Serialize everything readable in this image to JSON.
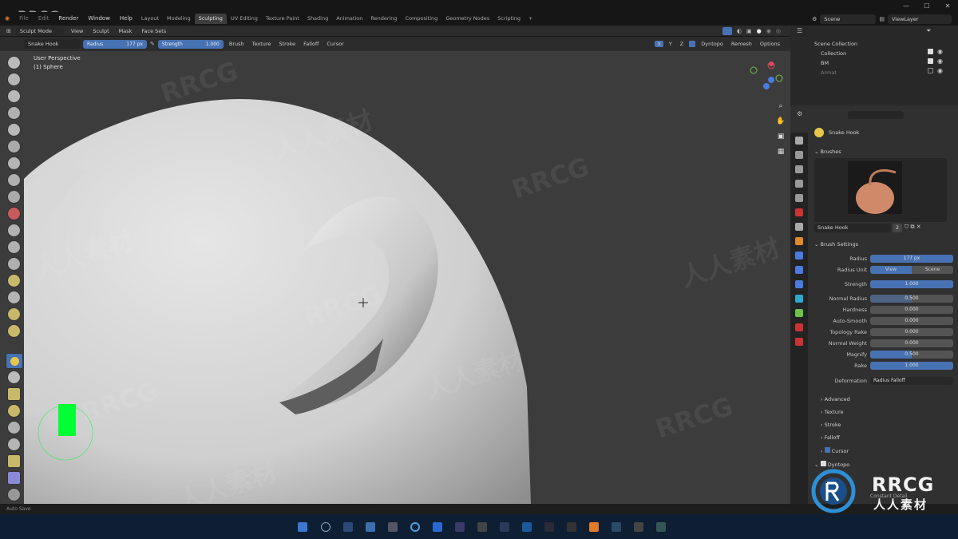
{
  "brand": "RRCG",
  "menu": {
    "items": [
      "File",
      "Edit",
      "Render",
      "Window",
      "Help"
    ],
    "workspaces": [
      "Layout",
      "Modeling",
      "Sculpting",
      "UV Editing",
      "Texture Paint",
      "Shading",
      "Animation",
      "Rendering",
      "Compositing",
      "Geometry Nodes",
      "Scripting"
    ],
    "active_workspace": "Sculpting",
    "add_tab": "+"
  },
  "header_right": {
    "scene": "Scene",
    "view_layer": "ViewLayer"
  },
  "viewport_header": {
    "mode": "Sculpt Mode",
    "menus": [
      "View",
      "Sculpt",
      "Mask",
      "Face Sets"
    ],
    "dyntopo": "Dyntopo",
    "remesh": "Remesh",
    "options": "Options",
    "axes": [
      "X",
      "Y",
      "Z"
    ]
  },
  "tool_settings": {
    "brush_name": "Snake Hook",
    "radius_label": "Radius",
    "radius_value": "177 px",
    "strength_label": "Strength",
    "strength_value": "1.000",
    "menus": [
      "Brush",
      "Texture",
      "Stroke",
      "Falloff",
      "Cursor"
    ]
  },
  "viewport": {
    "perspective": "User Perspective",
    "object": "(1) Sphere"
  },
  "outliner": {
    "title": "Scene Collection",
    "items": [
      "Collection",
      "BM",
      "Armat"
    ]
  },
  "properties": {
    "brush_header": "Snake Hook",
    "brushes_section": "Brushes",
    "brush_field": "Snake Hook",
    "brush_users": "2",
    "brush_settings_section": "Brush Settings",
    "rows": [
      {
        "label": "Radius",
        "value": "177 px",
        "fill": 1.0
      },
      {
        "label": "Strength",
        "value": "1.000",
        "fill": 1.0
      },
      {
        "label": "Normal Radius",
        "value": "0.500",
        "fill": 0.5
      },
      {
        "label": "Hardness",
        "value": "0.000",
        "fill": 0.0
      },
      {
        "label": "Auto-Smooth",
        "value": "0.000",
        "fill": 0.0
      },
      {
        "label": "Topology Rake",
        "value": "0.000",
        "fill": 0.0
      },
      {
        "label": "Normal Weight",
        "value": "0.000",
        "fill": 0.0
      },
      {
        "label": "Magnify",
        "value": "0.500",
        "fill": 0.5
      },
      {
        "label": "Rake",
        "value": "1.000",
        "fill": 1.0
      }
    ],
    "radius_unit_label": "Radius Unit",
    "radius_unit_options": [
      "View",
      "Scene"
    ],
    "deformation_label": "Deformation",
    "deformation_value": "Radius Falloff",
    "subsections": [
      "Advanced",
      "Texture",
      "Stroke",
      "Falloff",
      "Cursor"
    ],
    "dyntopo_section": "Dyntopo",
    "detail_label": "Constant Detail"
  },
  "statusbar": {
    "text": "Auto Save"
  },
  "watermarks": [
    "RRCG",
    "人人素材"
  ],
  "logo": {
    "main": "RRCG",
    "sub": "人人素材"
  },
  "colors": {
    "accent": "#4772b3",
    "brush_cursor": "#00ff33"
  }
}
